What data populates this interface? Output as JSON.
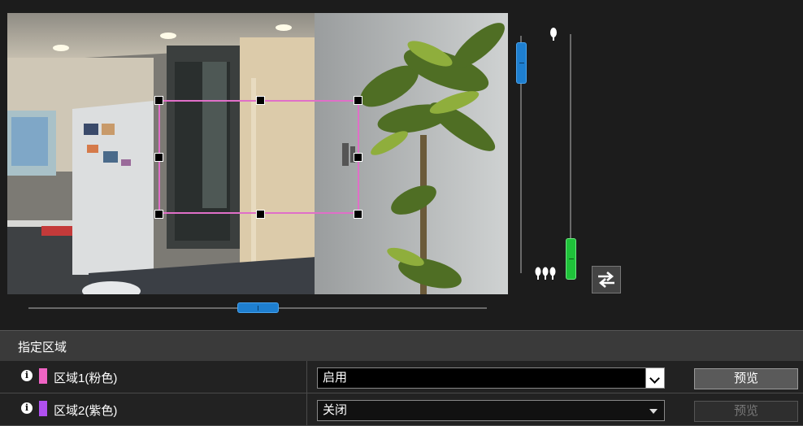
{
  "section": {
    "title": "指定区域"
  },
  "regions": [
    {
      "label": "区域1(粉色)",
      "color": "#f064c4",
      "state": "启用",
      "preview_label": "预览",
      "preview_enabled": true
    },
    {
      "label": "区域2(紫色)",
      "color": "#b050f0",
      "state": "关闭",
      "preview_label": "预览",
      "preview_enabled": false
    }
  ],
  "icons": {
    "info": "info-icon",
    "single_tree": "single-tree-icon",
    "many_trees": "multiple-trees-icon",
    "swap": "swap-arrows-icon"
  },
  "accent_colors": {
    "slider_blue": "#1e7fd0",
    "slider_green": "#1fc23a",
    "region_outline": "#e06fc8"
  }
}
